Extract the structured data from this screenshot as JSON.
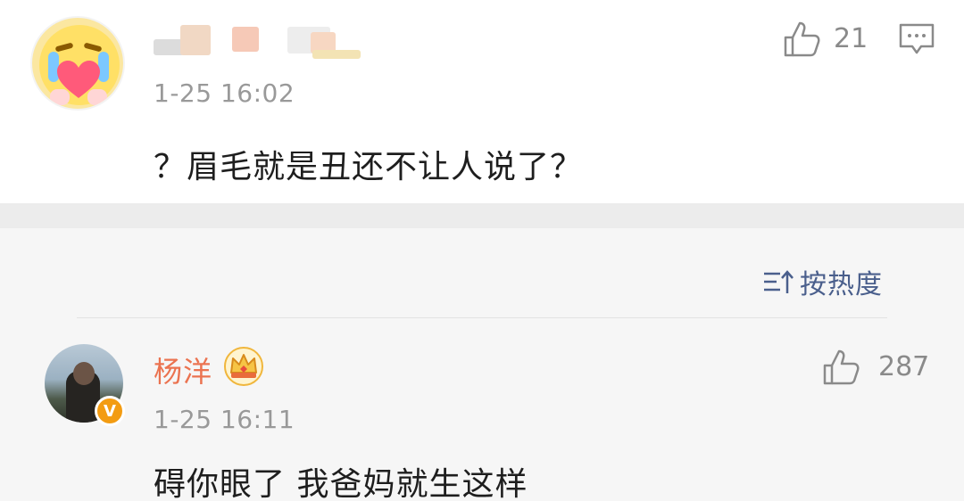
{
  "comments": [
    {
      "author": "",
      "timestamp": "1-25 16:02",
      "text": "？眉毛就是丑还不让人说了？",
      "likes": "21",
      "avatar_icon": "crying-heart-emoji-avatar",
      "like_icon": "thumbs-up-icon",
      "reply_icon": "comment-icon"
    },
    {
      "author": "杨洋",
      "timestamp": "1-25 16:11",
      "text": "碍你眼了 我爸妈就生这样",
      "likes": "287",
      "verified_badge": "V",
      "avatar_icon": "user-photo-avatar",
      "like_icon": "thumbs-up-icon",
      "member_icon": "crown-icon"
    }
  ],
  "sort": {
    "label": "按热度",
    "icon": "sort-icon"
  },
  "colors": {
    "author_highlight": "#eb7350",
    "link_blue": "#4a5f8c",
    "meta_gray": "#999999",
    "text_dark": "#1e1e1e"
  }
}
